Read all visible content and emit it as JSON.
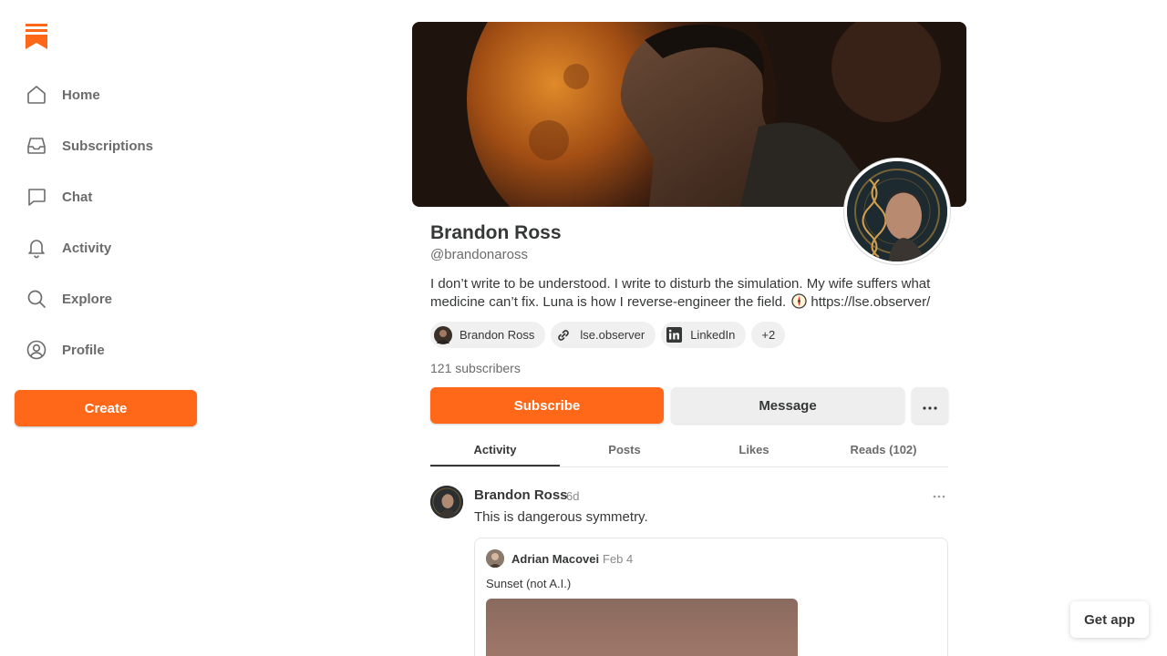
{
  "colors": {
    "accent": "#ff6719",
    "text_primary": "#363737",
    "text_secondary": "#6b6b6b",
    "chip_bg": "#f0f0f0"
  },
  "sidebar": {
    "logo_icon": "substack-logo-icon",
    "items": [
      {
        "label": "Home",
        "icon": "home-icon"
      },
      {
        "label": "Subscriptions",
        "icon": "inbox-icon"
      },
      {
        "label": "Chat",
        "icon": "chat-bubble-icon"
      },
      {
        "label": "Activity",
        "icon": "bell-icon"
      },
      {
        "label": "Explore",
        "icon": "search-icon"
      },
      {
        "label": "Profile",
        "icon": "user-circle-icon"
      }
    ],
    "create_label": "Create"
  },
  "profile": {
    "name": "Brandon Ross",
    "handle": "@brandonaross",
    "bio": "I don’t write to be understood. I write to disturb the simulation. My wife suffers what medicine can’t fix. Luna is how I reverse-engineer the field.",
    "bio_link": "https://lse.observer/",
    "chips": [
      {
        "label": "Brandon Ross",
        "icon": "avatar-icon"
      },
      {
        "label": "lse.observer",
        "icon": "link-icon"
      },
      {
        "label": "LinkedIn",
        "icon": "linkedin-icon"
      },
      {
        "label": "+2"
      }
    ],
    "subscribers": "121 subscribers",
    "subscribe_label": "Subscribe",
    "message_label": "Message"
  },
  "tabs": [
    {
      "label": "Activity",
      "active": true
    },
    {
      "label": "Posts",
      "active": false
    },
    {
      "label": "Likes",
      "active": false
    },
    {
      "label": "Reads (102)",
      "active": false
    }
  ],
  "post": {
    "author": "Brandon Ross",
    "time": "6d",
    "text": "This is dangerous symmetry.",
    "quote": {
      "author": "Adrian Macovei",
      "time": "Feb 4",
      "text": "Sunset (not A.I.)"
    }
  },
  "get_app_label": "Get app"
}
